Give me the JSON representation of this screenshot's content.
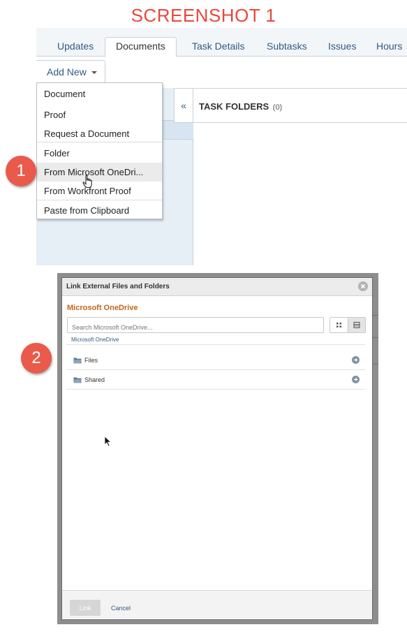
{
  "heading": "SCREENSHOT 1",
  "badges": [
    "1",
    "2"
  ],
  "screenshot1": {
    "tabs": [
      "Updates",
      "Documents",
      "Task Details",
      "Subtasks",
      "Issues",
      "Hours"
    ],
    "active_tab": "Documents",
    "add_new_label": "Add New",
    "add_new_menu": [
      "Document",
      "Proof",
      "Request a Document",
      "Folder",
      "From Microsoft OneDri...",
      "From Workfront Proof",
      "Paste from Clipboard"
    ],
    "hovered_item": "From Microsoft OneDri...",
    "collapse_glyph": "«",
    "task_folders_title": "TASK FOLDERS",
    "task_folders_count": "(0)"
  },
  "screenshot2": {
    "dialog_title": "Link External Files and Folders",
    "provider_title": "Microsoft OneDrive",
    "search_placeholder": "Search Microsoft OneDrive...",
    "breadcrumb": "Microsoft OneDrive",
    "items": [
      "Files",
      "Shared"
    ],
    "link_button": "Link",
    "cancel_link": "Cancel"
  },
  "colors": {
    "accent_red": "#e8483c",
    "link_blue": "#2e5b85",
    "onedrive_orange": "#c2651a"
  },
  "icons": [
    "chevron-down-icon",
    "double-chevron-left-icon",
    "hand-pointer-icon",
    "close-icon",
    "grid-view-icon",
    "list-view-icon",
    "folder-icon",
    "arrow-circle-right-icon",
    "mouse-pointer-icon"
  ]
}
